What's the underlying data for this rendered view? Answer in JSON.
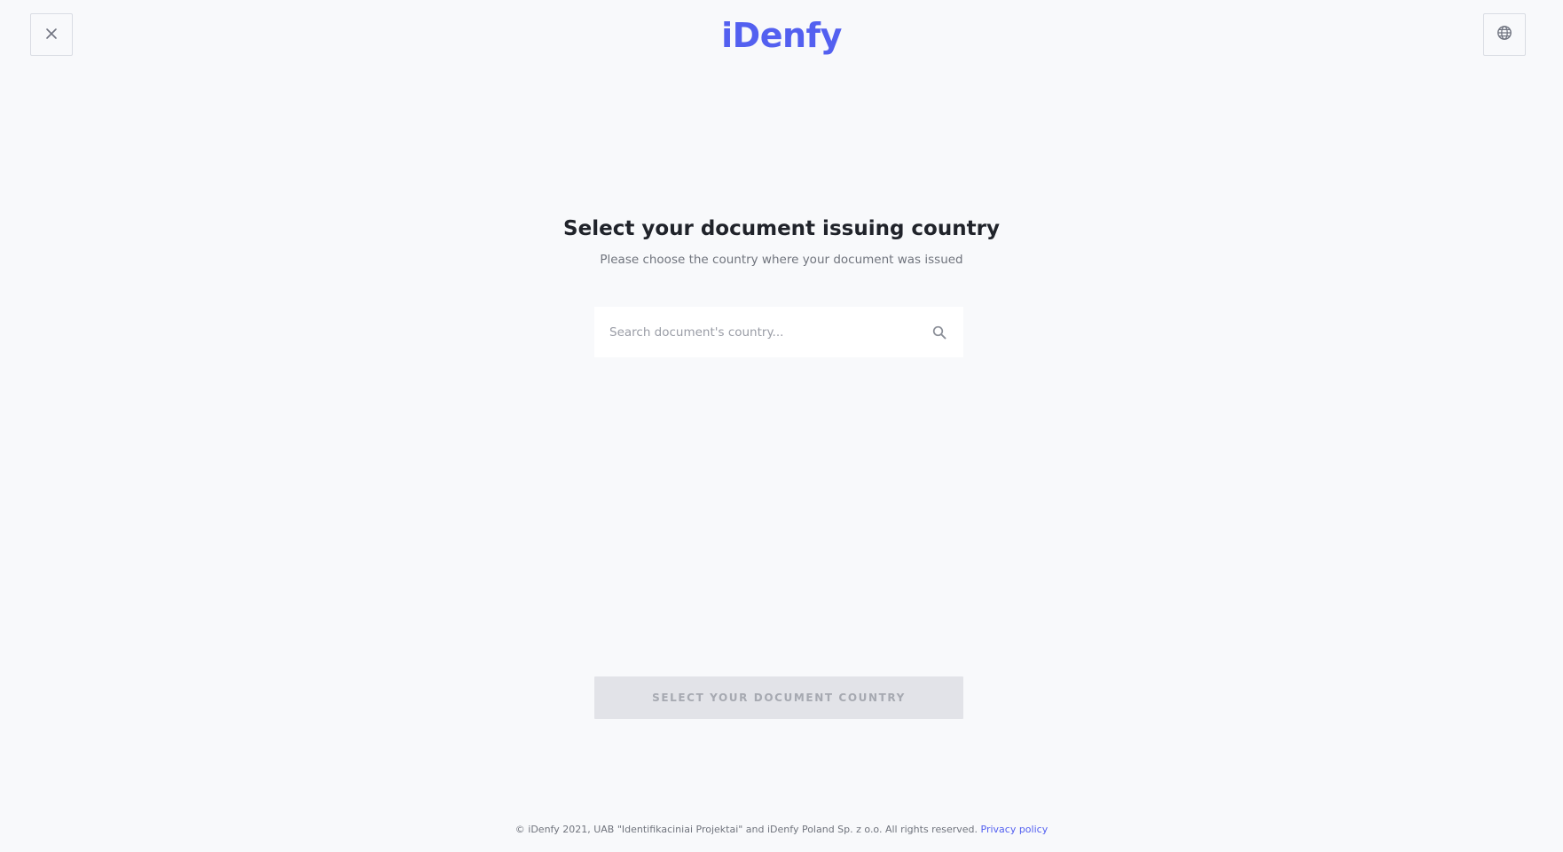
{
  "header": {
    "logo_text": "iDenfy",
    "close_icon": "close-icon",
    "language_icon": "globe-icon"
  },
  "main": {
    "title": "Select your document issuing country",
    "subtitle": "Please choose the country where your document was issued",
    "search": {
      "placeholder": "Search document's country...",
      "value": "",
      "icon": "search-icon"
    },
    "submit_label": "SELECT YOUR DOCUMENT COUNTRY",
    "submit_enabled": false
  },
  "footer": {
    "copyright": "© iDenfy 2021, UAB \"Identifikaciniai Projektai\" and iDenfy Poland Sp. z o.o. All rights reserved.",
    "privacy_link": "Privacy policy"
  },
  "colors": {
    "brand": "#5360f0",
    "background": "#f8f9fb",
    "disabled_button": "#e2e3e8"
  }
}
